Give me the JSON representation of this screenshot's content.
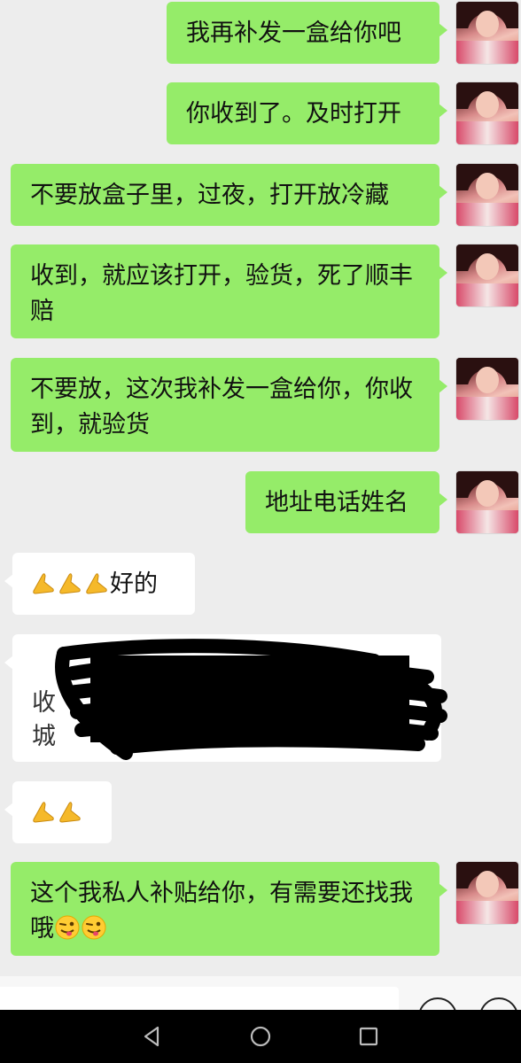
{
  "messages": [
    {
      "side": "out",
      "text": "我再补发一盒给你吧"
    },
    {
      "side": "out",
      "text": "你收到了。及时打开"
    },
    {
      "side": "out",
      "text": "不要放盒子里，过夜，打开放冷藏"
    },
    {
      "side": "out",
      "text": "收到，就应该打开，验货，死了顺丰赔"
    },
    {
      "side": "out",
      "text": "不要放，这次我补发一盒给你，你收到，就验货"
    },
    {
      "side": "out",
      "text": "地址电话姓名"
    },
    {
      "side": "in",
      "text": "好的",
      "emoji": "folded-hands-emoji",
      "emoji_count": 3
    },
    {
      "side": "in",
      "text": "",
      "redacted": true,
      "partial_chars": [
        "收",
        "城"
      ]
    },
    {
      "side": "in",
      "text": "",
      "emoji": "folded-hands-emoji",
      "emoji_count": 2
    },
    {
      "side": "out",
      "text": "这个我私人补贴给你，有需要还找我哦",
      "emoji": "winking-face-tongue-emoji",
      "emoji_count": 2
    }
  ],
  "colors": {
    "background": "#ededed",
    "outgoing_bubble": "#95ec69",
    "incoming_bubble": "#ffffff",
    "navbar": "#000000"
  },
  "navbar": {
    "icons": [
      "back-triangle-icon",
      "home-circle-icon",
      "recents-square-icon"
    ]
  }
}
